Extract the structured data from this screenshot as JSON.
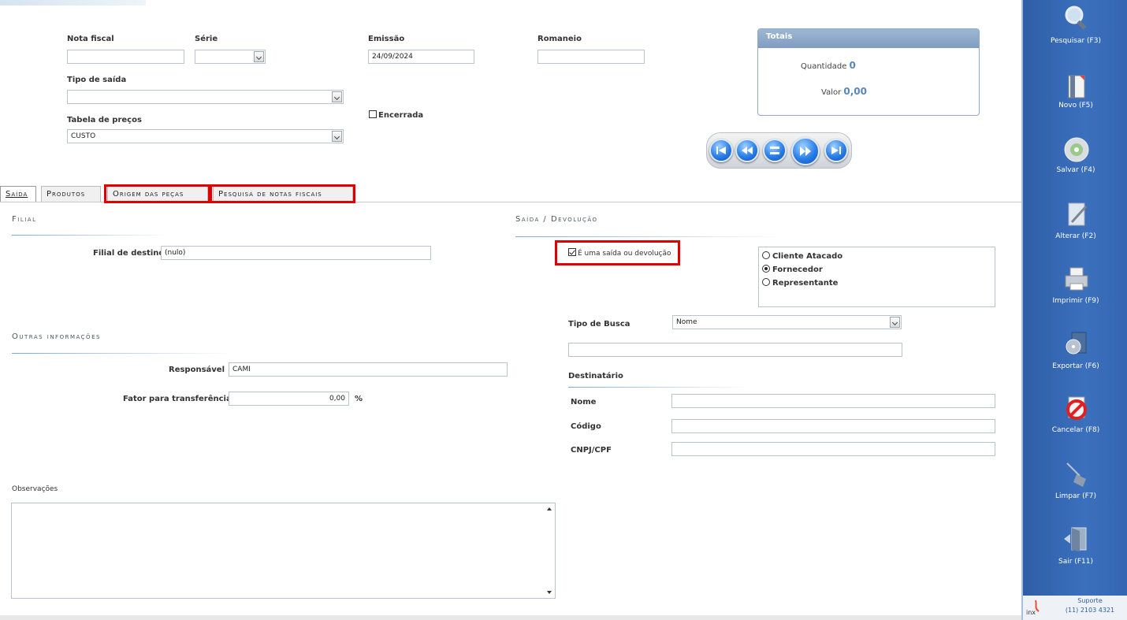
{
  "header": {
    "nota_fiscal_label": "Nota fiscal",
    "nota_fiscal_value": "",
    "serie_label": "Série",
    "serie_value": "",
    "emissao_label": "Emissão",
    "emissao_value": "24/09/2024",
    "romaneio_label": "Romaneio",
    "romaneio_value": "",
    "tipo_saida_label": "Tipo de saída",
    "tipo_saida_value": "",
    "tabela_precos_label": "Tabela de preços",
    "tabela_precos_value": "CUSTO",
    "encerrada_label": "Encerrada",
    "encerrada_checked": false
  },
  "totais": {
    "title": "Totais",
    "quantidade_label": "Quantidade",
    "quantidade_value": "0",
    "valor_label": "Valor",
    "valor_value": "0,00"
  },
  "navigation": [
    "first-icon",
    "previous-icon",
    "list-icon",
    "next-icon",
    "last-icon"
  ],
  "tabs": [
    {
      "label": "Saída",
      "selected": true
    },
    {
      "label": "Produtos",
      "selected": false
    },
    {
      "label": "Origem das peças",
      "selected": false
    },
    {
      "label": "Pesquisa de notas fiscais",
      "selected": false
    }
  ],
  "filial": {
    "title": "Filial",
    "filial_destino_label": "Filial de destino",
    "filial_destino_value": "(nulo)"
  },
  "outras": {
    "title": "Outras informações",
    "responsavel_label": "Responsável",
    "responsavel_value": "CAMI",
    "fator_label": "Fator para transferência",
    "fator_value": "0,00",
    "fator_unit": "%",
    "observacoes_label": "Observações",
    "observacoes_value": ""
  },
  "saida_devolucao": {
    "title": "Saída / Devolução",
    "checkbox_label": "É uma saída ou devolução",
    "checkbox_checked": true,
    "radio_options": [
      "Cliente Atacado",
      "Fornecedor",
      "Representante"
    ],
    "radio_selected": "Fornecedor",
    "tipo_busca_label": "Tipo de Busca",
    "tipo_busca_value": "Nome",
    "busca_value": "",
    "destinatario_title": "Destinatário",
    "nome_label": "Nome",
    "nome_value": "",
    "codigo_label": "Código",
    "codigo_value": "",
    "cnpj_label": "CNPJ/CPF",
    "cnpj_value": ""
  },
  "sidebar": {
    "items": [
      {
        "label": "Pesquisar (F3)",
        "icon": "magnifier-icon"
      },
      {
        "label": "Novo (F5)",
        "icon": "new-document-icon"
      },
      {
        "label": "Salvar (F4)",
        "icon": "disk-icon"
      },
      {
        "label": "Alterar (F2)",
        "icon": "edit-icon"
      },
      {
        "label": "Imprimir (F9)",
        "icon": "printer-icon"
      },
      {
        "label": "Exportar (F6)",
        "icon": "export-icon"
      },
      {
        "label": "Cancelar (F8)",
        "icon": "cancel-icon"
      },
      {
        "label": "Limpar (F7)",
        "icon": "broom-icon"
      },
      {
        "label": "Sair (F11)",
        "icon": "exit-door-icon"
      }
    ],
    "suporte_label": "Suporte",
    "suporte_phone": "(11) 2103 4321",
    "brand": "inx"
  },
  "colors": {
    "sidebar": "#3466b2",
    "highlight": "#e00000",
    "totais_header": "#8fa9c9"
  }
}
